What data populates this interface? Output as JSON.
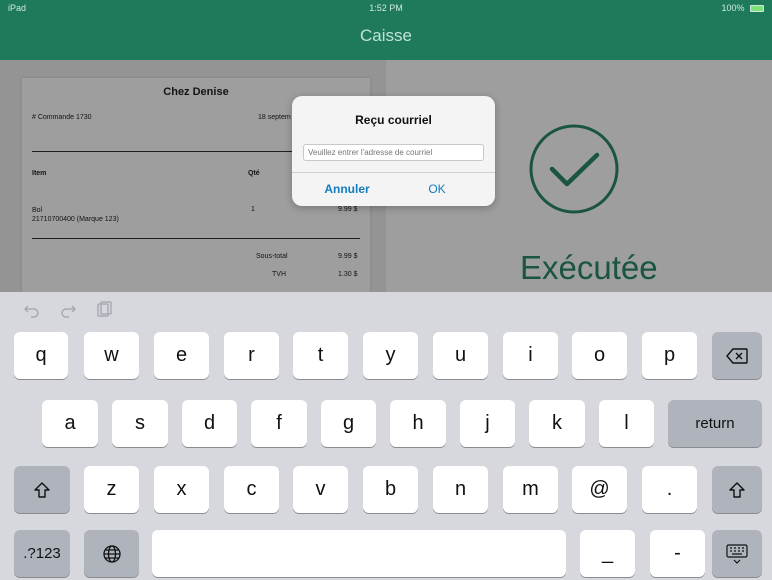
{
  "status_bar": {
    "carrier": "iPad",
    "time": "1:52 PM",
    "battery": "100%"
  },
  "navbar": {
    "title": "Caisse"
  },
  "receipt": {
    "store_name": "Chez Denise",
    "order_number": "# Commande 1730",
    "date": "18 septem",
    "headers": {
      "item": "Item",
      "qty": "Qté"
    },
    "line_item": {
      "name": "Bol",
      "code": "21710700400 (Marque 123)",
      "qty": "1",
      "price": "9.99 $"
    },
    "subtotal_label": "Sous-total",
    "subtotal_value": "9.99 $",
    "tax_label": "TVH",
    "tax_value": "1.30 $"
  },
  "status": {
    "label": "Exécutée",
    "icon": "checkmark-circle-icon",
    "color": "#2a8a6a"
  },
  "dialog": {
    "title": "Reçu courriel",
    "input_placeholder": "Veuillez entrer l'adresse de courriel",
    "input_value": "",
    "cancel_label": "Annuler",
    "ok_label": "OK"
  },
  "keyboard": {
    "row1": [
      "q",
      "w",
      "e",
      "r",
      "t",
      "y",
      "u",
      "i",
      "o",
      "p"
    ],
    "row2": [
      "a",
      "s",
      "d",
      "f",
      "g",
      "h",
      "j",
      "k",
      "l"
    ],
    "row3": [
      "z",
      "x",
      "c",
      "v",
      "b",
      "n",
      "m",
      "@",
      "."
    ],
    "return_label": "return",
    "numbers_label": ".?123",
    "bottom_keys": [
      "_",
      "-"
    ]
  }
}
